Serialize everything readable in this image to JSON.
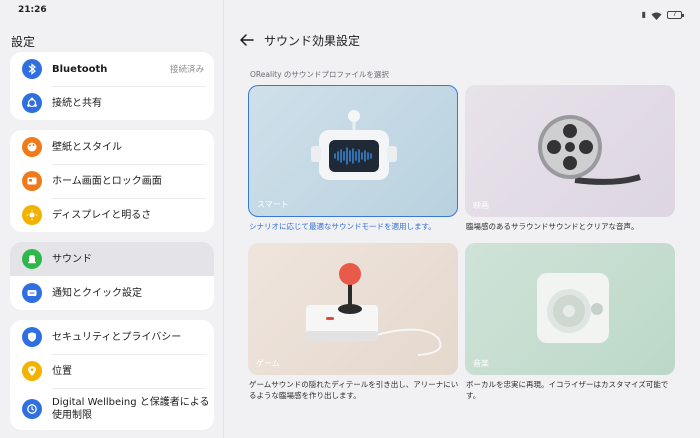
{
  "status": {
    "time": "21:26",
    "battery": "7"
  },
  "left": {
    "title": "設定",
    "groups": [
      [
        {
          "label": "Bluetooth",
          "value": "接続済み",
          "icon": "bluetooth-icon",
          "color": "#2f6fe0"
        },
        {
          "label": "接続と共有",
          "icon": "share-icon",
          "color": "#2f6fe0"
        }
      ],
      [
        {
          "label": "壁紙とスタイル",
          "icon": "palette-icon",
          "color": "#f07a1a"
        },
        {
          "label": "ホーム画面とロック画面",
          "icon": "home-screen-icon",
          "color": "#f07a1a"
        },
        {
          "label": "ディスプレイと明るさ",
          "icon": "brightness-icon",
          "color": "#f2b200"
        }
      ],
      [
        {
          "label": "サウンド",
          "icon": "sound-icon",
          "color": "#2fb84a"
        },
        {
          "label": "通知とクイック設定",
          "icon": "notification-icon",
          "color": "#2f6fe0"
        }
      ],
      [
        {
          "label": "セキュリティとプライバシー",
          "icon": "shield-icon",
          "color": "#2f6fe0"
        },
        {
          "label": "位置",
          "icon": "location-icon",
          "color": "#f2b200"
        },
        {
          "label": "Digital Wellbeing と保護者による使用制限",
          "icon": "wellbeing-icon",
          "color": "#2f6fe0"
        }
      ]
    ]
  },
  "right": {
    "title": "サウンド効果設定",
    "section": "OReality のサウンドプロファイルを選択",
    "tiles": [
      {
        "label": "スマート",
        "desc": "シナリオに応じて最適なサウンドモードを適用します。"
      },
      {
        "label": "映画",
        "desc": "臨場感のあるサラウンドサウンドとクリアな音声。"
      },
      {
        "label": "ゲーム",
        "desc": "ゲームサウンドの隠れたディテールを引き出し、アリーナにいるような臨場感を作り出します。"
      },
      {
        "label": "音楽",
        "desc": "ボーカルを忠実に再現。イコライザーはカスタマイズ可能です。"
      }
    ]
  }
}
